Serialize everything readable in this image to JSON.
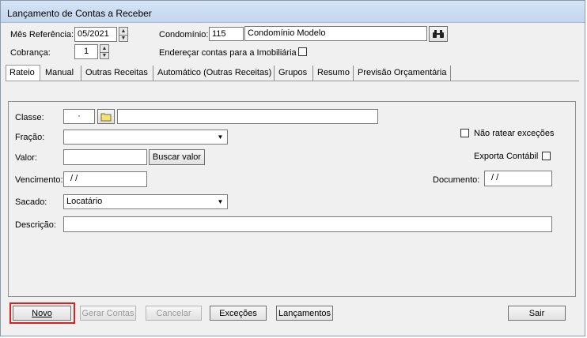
{
  "window": {
    "title": "Lançamento de Contas a Receber"
  },
  "header": {
    "mes_referencia_label": "Mês Referência:",
    "mes_referencia_value": "05/2021",
    "cobranca_label": "Cobrança:",
    "cobranca_value": "1",
    "condominio_label": "Condomínio:",
    "condominio_code": "115",
    "condominio_name": "Condomínio Modelo",
    "enderecar_label": "Endereçar contas para a Imobiliária",
    "enderecar_checked": false
  },
  "tabs": [
    {
      "label": "Rateio",
      "active": true
    },
    {
      "label": "Manual"
    },
    {
      "label": "Outras Receitas"
    },
    {
      "label": "Automático (Outras Receitas)"
    },
    {
      "label": "Grupos"
    },
    {
      "label": "Resumo"
    },
    {
      "label": "Previsão Orçamentária"
    }
  ],
  "form": {
    "classe_label": "Classe:",
    "classe_code": "·",
    "classe_desc": "",
    "fracao_label": "Fração:",
    "fracao_value": "",
    "valor_label": "Valor:",
    "valor_value": "",
    "buscar_valor_label": "Buscar valor",
    "vencimento_label": "Vencimento:",
    "vencimento_value": "/ /",
    "sacado_label": "Sacado:",
    "sacado_value": "Locatário",
    "descricao_label": "Descrição:",
    "descricao_value": "",
    "nao_ratear_label": "Não ratear exceções",
    "exporta_contabil_label": "Exporta Contábil",
    "documento_label": "Documento:",
    "documento_value": "/ /"
  },
  "buttons": {
    "novo": "Novo",
    "gerar_contas": "Gerar Contas",
    "cancelar": "Cancelar",
    "excecoes": "Exceções",
    "lancamentos": "Lançamentos",
    "sair": "Sair"
  },
  "colors": {
    "highlight": "#e21d1d",
    "title_bg": "#c3d6ee"
  }
}
